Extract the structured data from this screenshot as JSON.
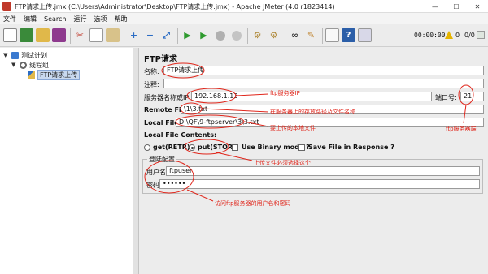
{
  "window": {
    "title": "FTP请求上传.jmx (C:\\Users\\Administrator\\Desktop\\FTP请求上传.jmx) - Apache JMeter (4.0 r1823414)",
    "minimize": "—",
    "maximize": "☐",
    "close": "✕"
  },
  "menu": [
    "文件",
    "编辑",
    "Search",
    "运行",
    "选项",
    "帮助"
  ],
  "toolbar": {
    "icons": [
      "new-icon",
      "templates-icon",
      "open-icon",
      "save-icon",
      "cut-icon",
      "copy-icon",
      "paste-icon",
      "expand-icon",
      "collapse-icon",
      "toggle-icon",
      "start-icon",
      "start-no-pause-icon",
      "stop-icon",
      "shutdown-icon",
      "clear-icon",
      "clear-all-icon",
      "search-icon",
      "reset-search-icon",
      "function-helper-icon",
      "help-icon",
      "settings-icon"
    ],
    "timer": "00:00:00",
    "warnings": "0",
    "threads": "0/0",
    "colors": {
      "start": "#2e9a2e",
      "stop": "#b0b0b0",
      "warning": "#e5b400"
    }
  },
  "tree": {
    "items": [
      {
        "label": "测试计划",
        "icon": "test-plan-icon"
      },
      {
        "label": "线程组",
        "icon": "gear-icon"
      },
      {
        "label": "FTP请求上传",
        "icon": "pipette-icon"
      }
    ]
  },
  "panel": {
    "title": "FTP请求",
    "name_label": "名称:",
    "name_value": "FTP请求上传",
    "comment_label": "注释:",
    "comment_value": "",
    "server_label": "服务器名称或IP:",
    "server_value": "192.168.1.13",
    "port_label": "端口号:",
    "port_value": "21",
    "remote_label": "Remote File:",
    "remote_value": "\\1\\3.txt",
    "local_label": "Local File:",
    "local_value": "D:\\QF\\9-ftpserver\\3\\3.txt",
    "content_label": "Local File Contents:",
    "get_label": "get(RETR)",
    "put_label": "put(STOR)",
    "binary_label": "Use Binary mode ?",
    "save_label": "Save File in Response ?",
    "login_section": "登陆配置",
    "user_label": "用户名",
    "user_value": "ftpuser",
    "password_label": "密码",
    "password_value": "••••••"
  },
  "annotations": {
    "server": "ftp服务器IP",
    "remote": "在服务器上的存放路径及文件名称",
    "local": "要上传的本地文件",
    "port": "ftp服务器端",
    "put": "上传文件必须选择这个",
    "login": "访问ftp服务器的用户名和密码",
    "color": "#e0261b"
  }
}
